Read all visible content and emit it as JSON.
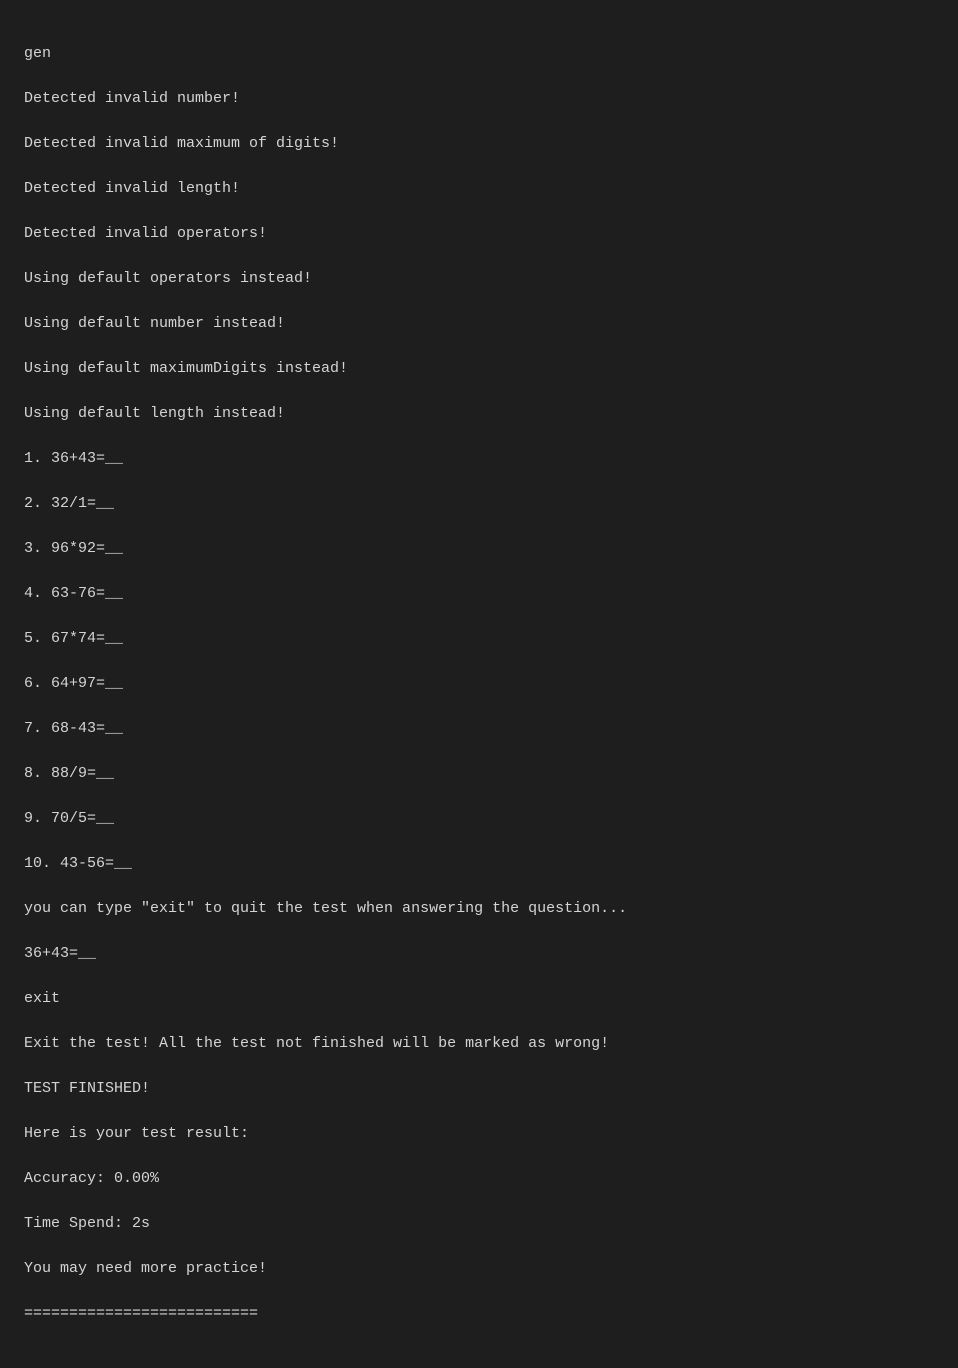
{
  "terminal": {
    "lines": [
      {
        "id": "line-gen",
        "text": "gen",
        "class": "text-normal"
      },
      {
        "id": "line-invalid-number",
        "text": "Detected invalid number!",
        "class": "text-normal"
      },
      {
        "id": "line-invalid-max-digits",
        "text": "Detected invalid maximum of digits!",
        "class": "text-normal"
      },
      {
        "id": "line-invalid-length",
        "text": "Detected invalid length!",
        "class": "text-normal"
      },
      {
        "id": "line-invalid-operators",
        "text": "Detected invalid operators!",
        "class": "text-normal"
      },
      {
        "id": "line-default-operators",
        "text": "Using default operators instead!",
        "class": "text-normal"
      },
      {
        "id": "line-default-number",
        "text": "Using default number instead!",
        "class": "text-normal"
      },
      {
        "id": "line-default-max-digits",
        "text": "Using default maximumDigits instead!",
        "class": "text-normal"
      },
      {
        "id": "line-default-length",
        "text": "Using default length instead!",
        "class": "text-normal"
      },
      {
        "id": "line-q1",
        "text": "1. 36+43=__",
        "class": "text-normal"
      },
      {
        "id": "line-q2",
        "text": "2. 32/1=__",
        "class": "text-normal"
      },
      {
        "id": "line-q3",
        "text": "3. 96*92=__",
        "class": "text-normal"
      },
      {
        "id": "line-q4",
        "text": "4. 63-76=__",
        "class": "text-normal"
      },
      {
        "id": "line-q5",
        "text": "5. 67*74=__",
        "class": "text-normal"
      },
      {
        "id": "line-q6",
        "text": "6. 64+97=__",
        "class": "text-normal"
      },
      {
        "id": "line-q7",
        "text": "7. 68-43=__",
        "class": "text-normal"
      },
      {
        "id": "line-q8",
        "text": "8. 88/9=__",
        "class": "text-normal"
      },
      {
        "id": "line-q9",
        "text": "9. 70/5=__",
        "class": "text-normal"
      },
      {
        "id": "line-q10",
        "text": "10. 43-56=__",
        "class": "text-normal"
      },
      {
        "id": "line-hint",
        "text": "you can type \"exit\" to quit the test when answering the question...",
        "class": "text-normal"
      },
      {
        "id": "line-prompt1",
        "text": "36+43=__",
        "class": "text-normal"
      },
      {
        "id": "line-exit-cmd",
        "text": "exit",
        "class": "text-normal"
      },
      {
        "id": "line-exit-msg",
        "text": "Exit the test! All the test not finished will be marked as wrong!",
        "class": "text-normal"
      },
      {
        "id": "line-test-finished",
        "text": "TEST FINISHED!",
        "class": "text-normal"
      },
      {
        "id": "line-result-header",
        "text": "Here is your test result:",
        "class": "text-normal"
      },
      {
        "id": "line-accuracy",
        "text": "Accuracy: 0.00%",
        "class": "text-normal"
      },
      {
        "id": "line-time",
        "text": "Time Spend: 2s",
        "class": "text-normal"
      },
      {
        "id": "line-practice",
        "text": "You may need more practice!",
        "class": "text-normal"
      },
      {
        "id": "line-separator",
        "text": "==========================",
        "class": "text-normal"
      }
    ]
  }
}
